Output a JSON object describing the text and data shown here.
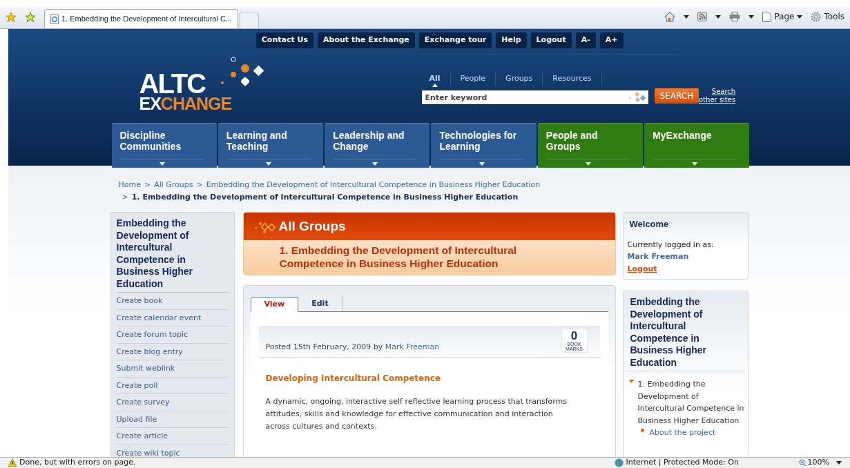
{
  "browser": {
    "tab_title": "1. Embedding the Development of Intercultural C...",
    "commands": [
      "Page",
      "Tools"
    ]
  },
  "top_links": [
    "Contact Us",
    "About the Exchange",
    "Exchange tour",
    "Help",
    "Logout",
    "A-",
    "A+"
  ],
  "logo": {
    "line1": "ALTC",
    "line2_white": "EX",
    "line2_orange": "CHANGE"
  },
  "search": {
    "scopes": [
      {
        "label": "All",
        "selected": true
      },
      {
        "label": "People",
        "selected": false
      },
      {
        "label": "Groups",
        "selected": false
      },
      {
        "label": "Resources",
        "selected": false
      }
    ],
    "placeholder": "Enter keyword",
    "button": "SEARCH",
    "other_link": [
      "Search",
      "other sites"
    ]
  },
  "nav": [
    {
      "label": "Discipline Communities",
      "color": "#2c5a94"
    },
    {
      "label": "Learning and Teaching",
      "color": "#2c5a94"
    },
    {
      "label": "Leadership and Change",
      "color": "#2c5a94"
    },
    {
      "label": "Technologies for Learning",
      "color": "#2c5a94"
    },
    {
      "label": "People and Groups",
      "color": "#2f7d12"
    },
    {
      "label": "MyExchange",
      "color": "#2f7d12"
    }
  ],
  "breadcrumb_separator": ">",
  "breadcrumb": [
    {
      "label": "Home",
      "current": false
    },
    {
      "label": "All Groups",
      "current": false
    },
    {
      "label": "Embedding the Development of Intercultural Competence in Business Higher Education",
      "current": false
    },
    {
      "label": "1. Embedding the Development of Intercultural Competence in Business Higher Education",
      "current": true
    }
  ],
  "sidebar": {
    "title": "Embedding the Development of Intercultural Competence in Business Higher Education",
    "links": [
      "Create book",
      "Create calendar event",
      "Create forum topic",
      "Create blog entry",
      "Submit weblink",
      "Create poll",
      "Create survey",
      "Upload file",
      "Create article",
      "Create wiki topic"
    ]
  },
  "main": {
    "heading": "All Groups",
    "subheading": "1. Embedding the Development of Intercultural Competence in Business Higher Education",
    "tabs": [
      {
        "label": "View",
        "selected": true
      },
      {
        "label": "Edit",
        "selected": false
      }
    ],
    "post": {
      "meta": "Posted 15th February, 2009 by",
      "author": "Mark Freeman",
      "bookmark_count": "0",
      "bookmark_label": [
        "BOOK",
        "MARKS"
      ],
      "title": "Developing Intercultural Competence",
      "body": "A dynamic, ongoing, interactive self reflective learning process that transforms attitudes, skills and knowledge for effective communication and interaction across cultures and contexts."
    }
  },
  "welcome": {
    "title": "Welcome",
    "text": "Currently logged in as:",
    "user": "Mark Freeman",
    "logout": "Logout"
  },
  "group_panel": {
    "title": "Embedding the Development of Intercultural Competence in Business Higher Education",
    "tree": [
      {
        "label": "1. Embedding the Development of Intercultural Competence in Business Higher Education",
        "expanded": true,
        "children": [
          {
            "label": "About the project"
          }
        ]
      }
    ]
  },
  "status_bar": {
    "message": "Done, but with errors on page.",
    "zone": "Internet | Protected Mode: On",
    "zoom": "100%"
  }
}
